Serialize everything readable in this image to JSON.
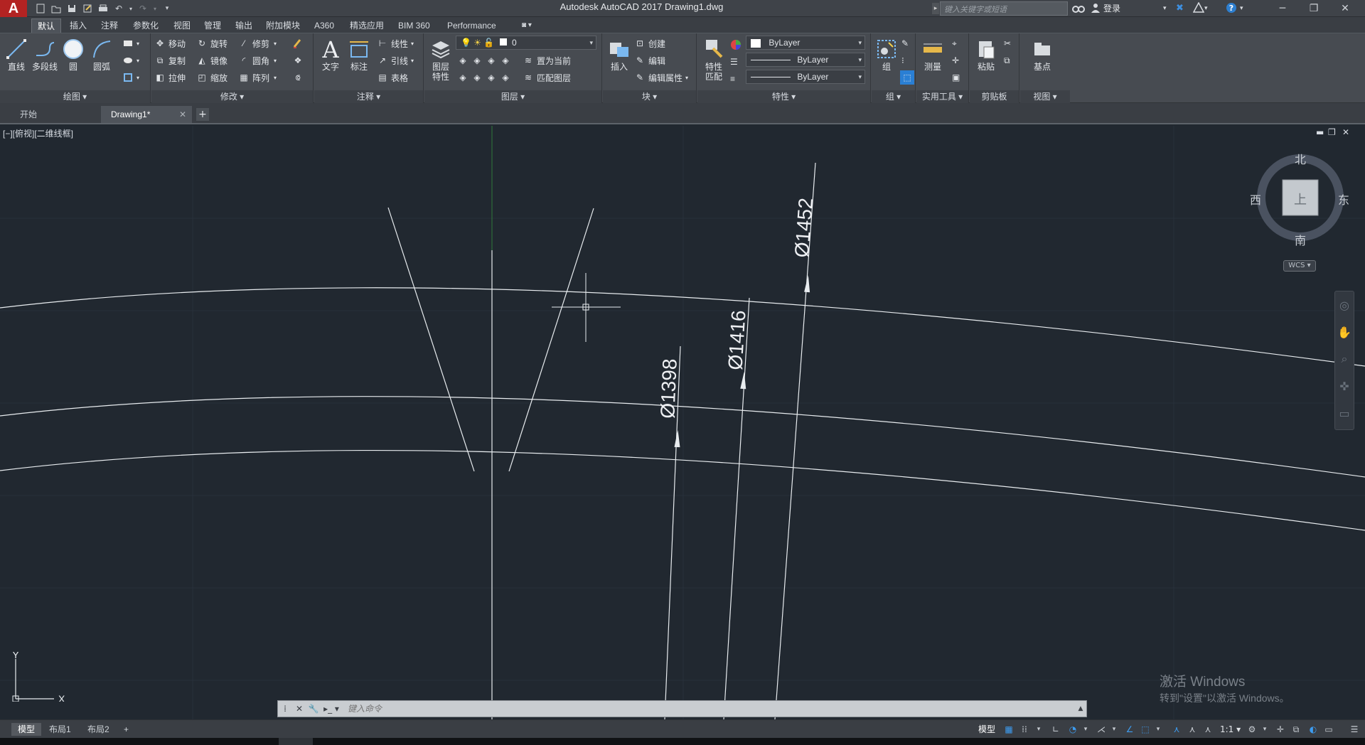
{
  "app": {
    "logo": "A",
    "title": "Autodesk AutoCAD 2017    Drawing1.dwg",
    "search_placeholder": "键入关键字或短语",
    "login": "登录"
  },
  "ribbon_tabs": [
    {
      "label": "默认",
      "active": true
    },
    {
      "label": "插入"
    },
    {
      "label": "注释"
    },
    {
      "label": "参数化"
    },
    {
      "label": "视图"
    },
    {
      "label": "管理"
    },
    {
      "label": "输出"
    },
    {
      "label": "附加模块"
    },
    {
      "label": "A360"
    },
    {
      "label": "精选应用"
    },
    {
      "label": "BIM 360"
    },
    {
      "label": "Performance"
    }
  ],
  "ribbon": {
    "draw": {
      "title": "绘图 ▾",
      "line": "直线",
      "polyline": "多段线",
      "circle": "圆",
      "arc": "圆弧"
    },
    "modify": {
      "title": "修改 ▾",
      "move": "移动",
      "rotate": "旋转",
      "trim": "修剪",
      "copy": "复制",
      "mirror": "镜像",
      "fillet": "圆角",
      "stretch": "拉伸",
      "scale": "缩放",
      "array": "阵列"
    },
    "annotation": {
      "title": "注释 ▾",
      "text": "文字",
      "dimension": "标注",
      "linear": "线性",
      "leader": "引线",
      "table": "表格"
    },
    "layers": {
      "title": "图层 ▾",
      "layer_props_1": "图层",
      "layer_props_2": "特性",
      "current_layer": "0",
      "set_current": "置为当前",
      "match_layer": "匹配图层"
    },
    "block": {
      "title": "块 ▾",
      "insert": "插入",
      "create": "创建",
      "edit": "编辑",
      "edit_attr": "编辑属性"
    },
    "properties": {
      "title": "特性 ▾",
      "match_1": "特性",
      "match_2": "匹配",
      "color": "ByLayer",
      "linetype": "ByLayer",
      "lineweight": "ByLayer"
    },
    "groups": {
      "title": "组 ▾",
      "group": "组"
    },
    "utilities": {
      "title": "实用工具 ▾",
      "measure": "测量"
    },
    "clipboard": {
      "title": "剪贴板",
      "paste": "粘贴"
    },
    "view": {
      "title": "视图 ▾",
      "base": "基点"
    }
  },
  "file_tabs": [
    {
      "label": "开始"
    },
    {
      "label": "Drawing1*",
      "active": true
    }
  ],
  "viewport": {
    "label": "[−][俯视][二维线框]"
  },
  "drawing": {
    "dimensions": [
      {
        "text": "Ø1452"
      },
      {
        "text": "Ø1416"
      },
      {
        "text": "Ø1398"
      }
    ]
  },
  "viewcube": {
    "north": "北",
    "south": "南",
    "east": "东",
    "west": "西",
    "face": "上",
    "wcs": "WCS ▾"
  },
  "ucs": {
    "x": "X",
    "y": "Y"
  },
  "watermark": {
    "title": "激活 Windows",
    "subtitle": "转到\"设置\"以激活 Windows。"
  },
  "command_line": {
    "placeholder": "键入命令"
  },
  "status_bar": {
    "layout_tabs": [
      {
        "label": "模型",
        "active": true
      },
      {
        "label": "布局1"
      },
      {
        "label": "布局2"
      }
    ],
    "model": "模型",
    "scale": "1:1 ▾"
  },
  "colors": {
    "canvas_bg": "#212830",
    "accent": "#2a7fd4",
    "logo_red": "#b32322"
  }
}
